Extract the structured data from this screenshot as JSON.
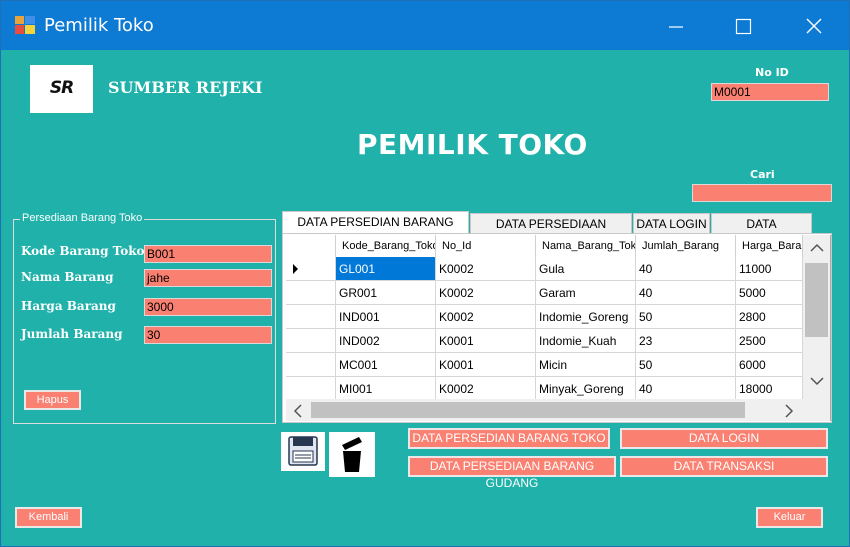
{
  "window": {
    "title": "Pemilik Toko",
    "min_glyph": "—",
    "max_glyph": "☐",
    "close_glyph": "✕"
  },
  "header": {
    "logo_text": "SR",
    "store_name": "SUMBER REJEKI",
    "page_title": "PEMILIK TOKO",
    "no_id_label": "No ID",
    "no_id_value": "M0001",
    "search_label": "Cari",
    "search_value": ""
  },
  "form": {
    "group_title": "Persediaan Barang Toko",
    "fields": [
      {
        "label": "Kode Barang Toko",
        "value": "B001"
      },
      {
        "label": "Nama Barang",
        "value": "jahe"
      },
      {
        "label": "Harga Barang",
        "value": "3000"
      },
      {
        "label": "Jumlah Barang",
        "value": "30"
      }
    ],
    "hapus_label": "Hapus"
  },
  "tabs": [
    {
      "label": "DATA PERSEDIAN BARANG TOKO",
      "active": true
    },
    {
      "label": "DATA PERSEDIAAN GUDANG",
      "active": false
    },
    {
      "label": "DATA LOGIN",
      "active": false
    },
    {
      "label": "DATA TRANSAKSI",
      "active": false
    }
  ],
  "grid": {
    "columns": [
      "Kode_Barang_Toko",
      "No_Id",
      "Nama_Barang_Toko",
      "Jumlah_Barang",
      "Harga_Barang"
    ],
    "rows": [
      [
        "GL001",
        "K0002",
        "Gula",
        "40",
        "11000"
      ],
      [
        "GR001",
        "K0002",
        "Garam",
        "40",
        "5000"
      ],
      [
        "IND001",
        "K0002",
        "Indomie_Goreng",
        "50",
        "2800"
      ],
      [
        "IND002",
        "K0001",
        "Indomie_Kuah",
        "23",
        "2500"
      ],
      [
        "MC001",
        "K0001",
        "Micin",
        "50",
        "6000"
      ],
      [
        "MI001",
        "K0002",
        "Minyak_Goreng",
        "40",
        "18000"
      ]
    ]
  },
  "nav_buttons": {
    "toko": "DATA PERSEDIAN BARANG TOKO",
    "login": "DATA LOGIN",
    "gudang": "DATA PERSEDIAAN BARANG GUDANG",
    "transaksi": "DATA TRANSAKSI"
  },
  "footer": {
    "kembali_label": "Kembali",
    "keluar_label": "Keluar"
  },
  "colors": {
    "background": "#20b2aa",
    "titlebar": "#0d7ad4",
    "accent": "#fa8072",
    "selection": "#0078d7"
  },
  "icons": [
    "save-icon",
    "delete-icon"
  ]
}
